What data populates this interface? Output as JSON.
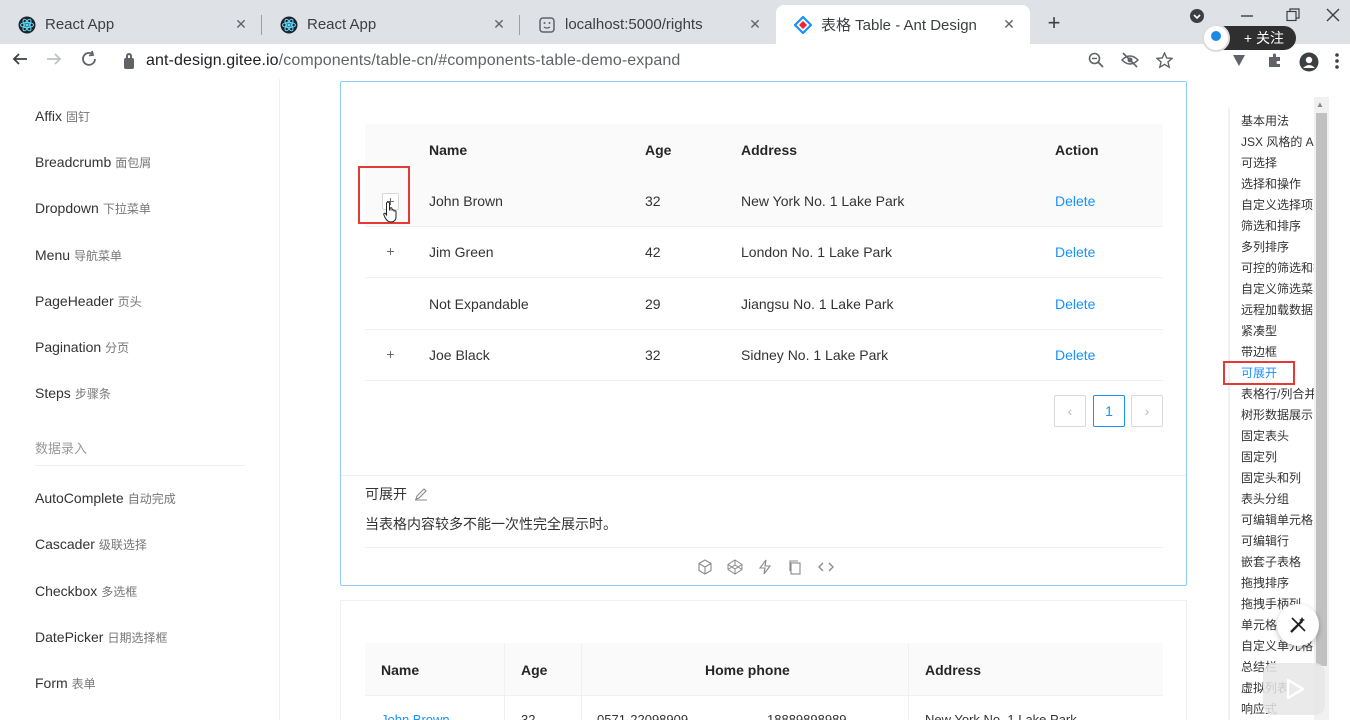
{
  "browser": {
    "tabs": [
      {
        "title": "React App",
        "close": "✕"
      },
      {
        "title": "React App",
        "close": "✕"
      },
      {
        "title": "localhost:5000/rights",
        "close": "✕"
      },
      {
        "title": "表格 Table - Ant Design",
        "close": "✕",
        "active": true
      }
    ],
    "new_tab": "+",
    "url_host": "ant-design.gitee.io",
    "url_path": "/components/table-cn/#components-table-demo-expand",
    "follow_label": "+ 关注"
  },
  "sidenav": {
    "items": [
      {
        "en": "Affix",
        "zh": "固钉"
      },
      {
        "en": "Breadcrumb",
        "zh": "面包屑"
      },
      {
        "en": "Dropdown",
        "zh": "下拉菜单"
      },
      {
        "en": "Menu",
        "zh": "导航菜单"
      },
      {
        "en": "PageHeader",
        "zh": "页头"
      },
      {
        "en": "Pagination",
        "zh": "分页"
      },
      {
        "en": "Steps",
        "zh": "步骤条"
      }
    ],
    "group": "数据录入",
    "items2": [
      {
        "en": "AutoComplete",
        "zh": "自动完成"
      },
      {
        "en": "Cascader",
        "zh": "级联选择"
      },
      {
        "en": "Checkbox",
        "zh": "多选框"
      },
      {
        "en": "DatePicker",
        "zh": "日期选择框"
      },
      {
        "en": "Form",
        "zh": "表单"
      }
    ]
  },
  "table": {
    "headers": {
      "name": "Name",
      "age": "Age",
      "address": "Address",
      "action": "Action"
    },
    "rows": [
      {
        "expand": "+",
        "name": "John Brown",
        "age": "32",
        "address": "New York No. 1 Lake Park",
        "action": "Delete"
      },
      {
        "expand": "+",
        "name": "Jim Green",
        "age": "42",
        "address": "London No. 1 Lake Park",
        "action": "Delete"
      },
      {
        "expand": "",
        "name": "Not Expandable",
        "age": "29",
        "address": "Jiangsu No. 1 Lake Park",
        "action": "Delete"
      },
      {
        "expand": "+",
        "name": "Joe Black",
        "age": "32",
        "address": "Sidney No. 1 Lake Park",
        "action": "Delete"
      }
    ],
    "pagination": {
      "prev": "‹",
      "current": "1",
      "next": "›"
    }
  },
  "demo": {
    "title": "可展开",
    "description": "当表格内容较多不能一次性完全展示时。"
  },
  "table2": {
    "headers": {
      "name": "Name",
      "age": "Age",
      "home_phone": "Home phone",
      "address": "Address"
    },
    "row": {
      "name": "John Brown",
      "age": "32",
      "phone1": "0571-22098909",
      "phone2": "18889898989",
      "address": "New York No. 1 Lake Park"
    }
  },
  "anchor": {
    "items": [
      "基本用法",
      "JSX 风格的 API",
      "可选择",
      "选择和操作",
      "自定义选择项",
      "筛选和排序",
      "多列排序",
      "可控的筛选和排序",
      "自定义筛选菜单",
      "远程加载数据",
      "紧凑型",
      "带边框",
      "可展开",
      "表格行/列合并",
      "树形数据展示",
      "固定表头",
      "固定列",
      "固定头和列",
      "表头分组",
      "可编辑单元格",
      "可编辑行",
      "嵌套子表格",
      "拖拽排序",
      "拖拽手柄列",
      "单元格自动省略",
      "自定义单元格",
      "总结栏",
      "虚拟列表",
      "响应式"
    ],
    "active": "可展开"
  },
  "colors": {
    "link": "#1890ff",
    "highlight": "#e53935",
    "card_border": "#91caff"
  }
}
